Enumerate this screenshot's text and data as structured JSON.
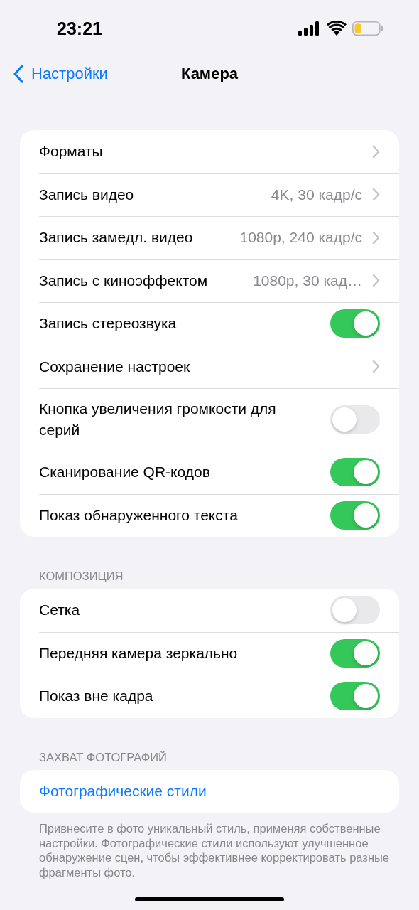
{
  "status_bar": {
    "time": "23:21"
  },
  "nav": {
    "back": "Настройки",
    "title": "Камера"
  },
  "groups": [
    {
      "rows": [
        {
          "kind": "link",
          "label": "Форматы"
        },
        {
          "kind": "link",
          "label": "Запись видео",
          "value": "4K, 30 кадр/с"
        },
        {
          "kind": "link",
          "label": "Запись замедл. видео",
          "value": "1080p, 240 кадр/с"
        },
        {
          "kind": "link",
          "label": "Запись с киноэффектом",
          "value": "1080p, 30 кад…"
        },
        {
          "kind": "toggle",
          "label": "Запись стереозвука",
          "on": true
        },
        {
          "kind": "link",
          "label": "Сохранение настроек"
        },
        {
          "kind": "toggle",
          "label": "Кнопка увеличения громкости для серий",
          "on": false
        },
        {
          "kind": "toggle",
          "label": "Сканирование QR-кодов",
          "on": true
        },
        {
          "kind": "toggle",
          "label": "Показ обнаруженного текста",
          "on": true
        }
      ]
    },
    {
      "header": "КОМПОЗИЦИЯ",
      "rows": [
        {
          "kind": "toggle",
          "label": "Сетка",
          "on": false
        },
        {
          "kind": "toggle",
          "label": "Передняя камера зеркально",
          "on": true
        },
        {
          "kind": "toggle",
          "label": "Показ вне кадра",
          "on": true
        }
      ]
    },
    {
      "header": "ЗАХВАТ ФОТОГРАФИЙ",
      "rows": [
        {
          "kind": "action",
          "label": "Фотографические стили"
        }
      ],
      "footer": "Привнесите в фото уникальный стиль, применяя собственные настройки. Фотографические стили используют улучшенное обнаружение сцен, чтобы эффективнее корректировать разные фрагменты фото."
    }
  ]
}
